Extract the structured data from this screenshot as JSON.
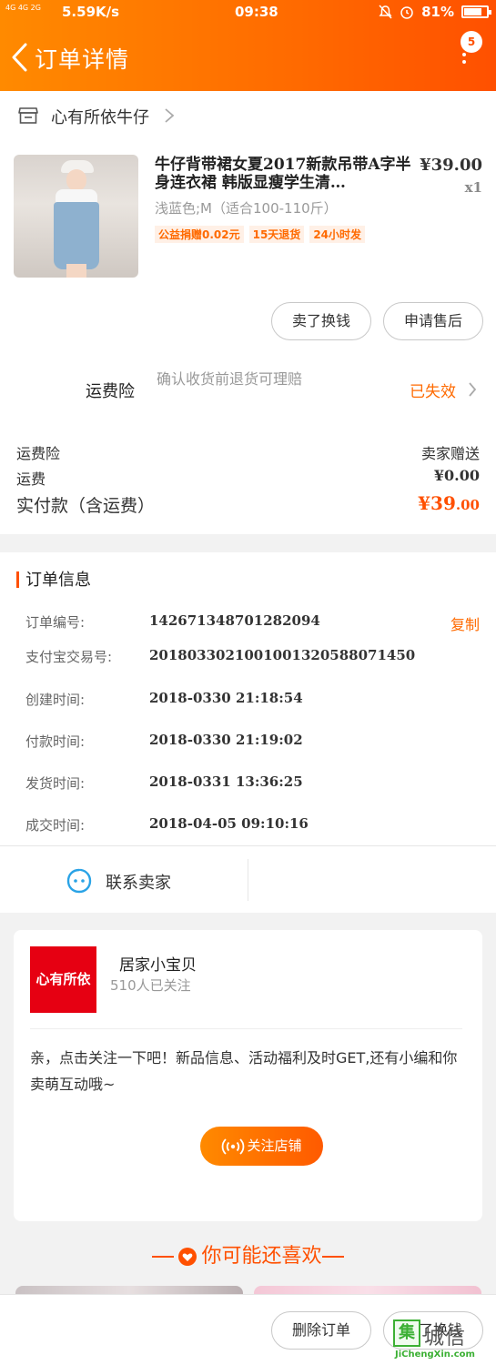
{
  "status_bar": {
    "network": "4G 4G 2G",
    "speed": "5.59K/s",
    "time": "09:38",
    "battery": "81%",
    "battery_level": 0.81
  },
  "header": {
    "title": "订单详情",
    "message_count": "5"
  },
  "shop": {
    "name": "心有所依牛仔"
  },
  "product": {
    "title": "牛仔背带裙女夏2017新款吊带A字半身连衣裙 韩版显瘦学生清…",
    "price": "¥39.00",
    "quantity": "x1",
    "spec": "浅蓝色;M（适合100-110斤）",
    "tags": [
      "公益捐赠0.02元",
      "15天退货",
      "24小时发"
    ]
  },
  "product_actions": {
    "sell_label": "卖了换钱",
    "after_sale_label": "申请售后"
  },
  "insurance": {
    "label": "运费险",
    "description": "确认收货前退货可理赔",
    "status": "已失效"
  },
  "costs": {
    "insurance_label": "运费险",
    "insurance_value": "卖家赠送",
    "shipping_label": "运费",
    "shipping_value": "¥0.00",
    "total_label": "实付款（含运费）",
    "total_main": "¥39",
    "total_decimal": ".00"
  },
  "order_info": {
    "title": "订单信息",
    "copy_label": "复制",
    "rows": [
      {
        "key": "订单编号:",
        "value": "142671348701282094"
      },
      {
        "key": "支付宝交易号:",
        "value": "2018033021001001320588071450"
      },
      {
        "key": "创建时间:",
        "value": "2018-0330 21:18:54"
      },
      {
        "key": "付款时间:",
        "value": "2018-0330 21:19:02"
      },
      {
        "key": "发货时间:",
        "value": "2018-0331 13:36:25"
      },
      {
        "key": "成交时间:",
        "value": "2018-04-05 09:10:16"
      }
    ]
  },
  "contact": {
    "label": "联系卖家"
  },
  "store": {
    "logo_text": "心有所依",
    "name": "居家小宝贝",
    "followers": "510人已关注",
    "message": "亲，点击关注一下吧！新品信息、活动福利及时GET,还有小编和你卖萌互动哦~",
    "follow_label": "关注店铺"
  },
  "recommend": {
    "title": "你可能还喜欢"
  },
  "bottom_bar": {
    "delete_label": "删除订单",
    "sell_label": "卖了换钱"
  },
  "watermark": {
    "mark": "集",
    "brand": "城信",
    "domain": "JiChengXin.com"
  },
  "colors": {
    "accent": "#ff5000",
    "header_start": "#ff8a00",
    "logo_red": "#e60012",
    "watermark_green": "#3cb034"
  }
}
